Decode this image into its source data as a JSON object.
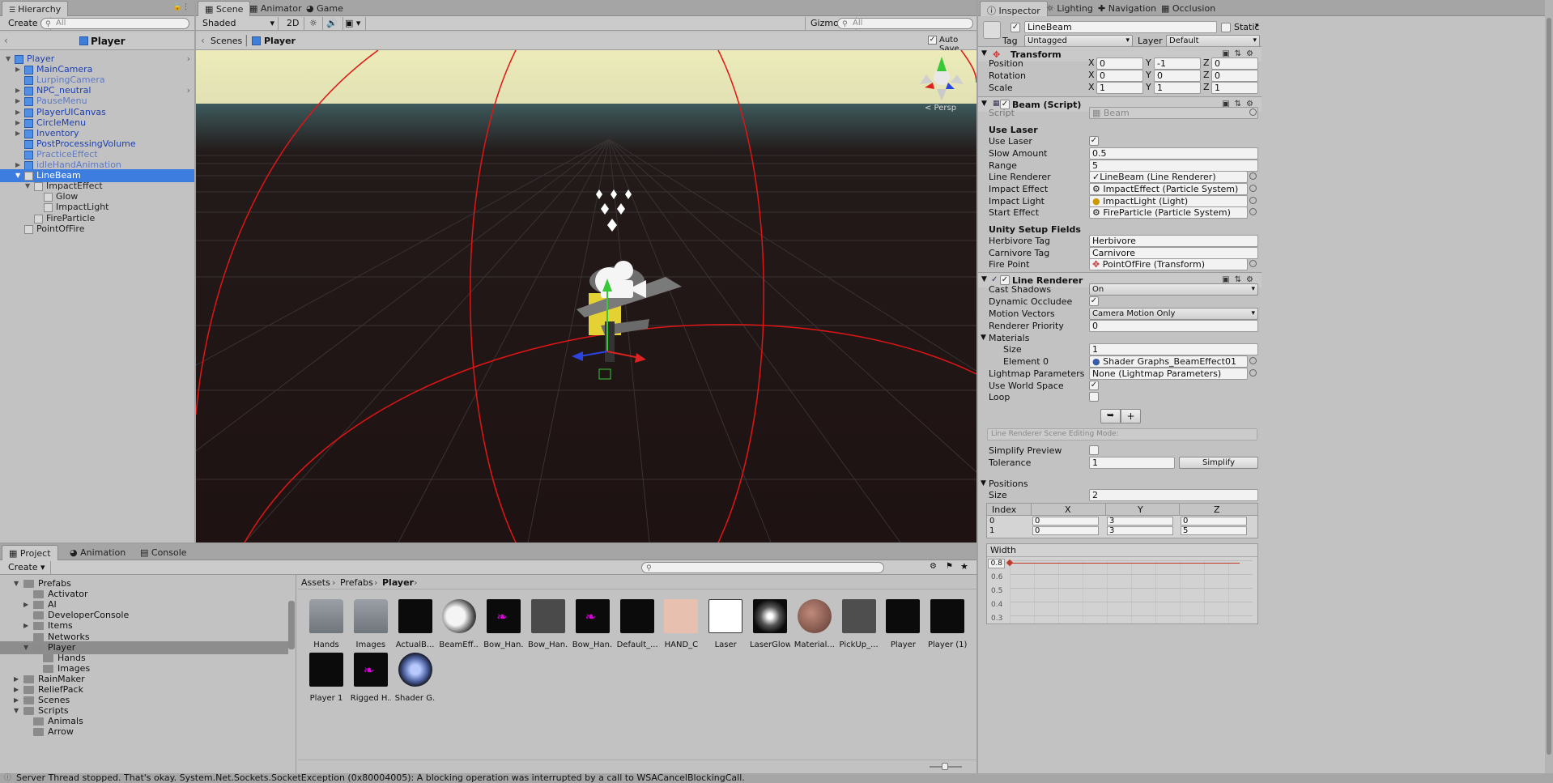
{
  "hierarchy": {
    "tab_label": "Hierarchy",
    "create_label": "Create",
    "search_placeholder": "All",
    "scene_title": "Player",
    "items": [
      {
        "label": "Player"
      },
      {
        "label": "MainCamera"
      },
      {
        "label": "LurpingCamera"
      },
      {
        "label": "NPC_neutral"
      },
      {
        "label": "PauseMenu"
      },
      {
        "label": "PlayerUICanvas"
      },
      {
        "label": "CircleMenu"
      },
      {
        "label": "Inventory"
      },
      {
        "label": "PostProcessingVolume"
      },
      {
        "label": "PracticeEffect"
      },
      {
        "label": "idleHandAnimation"
      },
      {
        "label": "LineBeam"
      },
      {
        "label": "ImpactEffect"
      },
      {
        "label": "Glow"
      },
      {
        "label": "ImpactLight"
      },
      {
        "label": "FireParticle"
      },
      {
        "label": "PointOfFire"
      }
    ]
  },
  "scene": {
    "tabs": [
      {
        "label": "Scene"
      },
      {
        "label": "Animator"
      },
      {
        "label": "Game"
      }
    ],
    "shading_mode": "Shaded",
    "mode_2d": "2D",
    "gizmos_label": "Gizmos",
    "search_placeholder": "All",
    "breadcrumb": [
      "Scenes",
      "Player"
    ],
    "auto_save_label": "Auto Save",
    "persp_label": "< Persp"
  },
  "inspector": {
    "tabs": [
      {
        "label": "Inspector"
      },
      {
        "label": "Lighting"
      },
      {
        "label": "Navigation"
      },
      {
        "label": "Occlusion"
      }
    ],
    "object_name": "LineBeam",
    "static_label": "Static",
    "tag_label": "Tag",
    "tag_value": "Untagged",
    "layer_label": "Layer",
    "layer_value": "Default",
    "transform": {
      "title": "Transform",
      "rows": [
        {
          "label": "Position",
          "x": "0",
          "y": "-1",
          "z": "0"
        },
        {
          "label": "Rotation",
          "x": "0",
          "y": "0",
          "z": "0"
        },
        {
          "label": "Scale",
          "x": "1",
          "y": "1",
          "z": "1"
        }
      ]
    },
    "beam": {
      "title": "Beam (Script)",
      "script_label": "Script",
      "script_value": "Beam",
      "section1": "Use Laser",
      "use_laser_label": "Use Laser",
      "slow_amount_label": "Slow Amount",
      "slow_amount_value": "0.5",
      "range_label": "Range",
      "range_value": "5",
      "line_renderer_label": "Line Renderer",
      "line_renderer_value": "LineBeam (Line Renderer)",
      "impact_effect_label": "Impact Effect",
      "impact_effect_value": "ImpactEffect (Particle System)",
      "impact_light_label": "Impact Light",
      "impact_light_value": "ImpactLight (Light)",
      "start_effect_label": "Start Effect",
      "start_effect_value": "FireParticle (Particle System)",
      "section2": "Unity Setup Fields",
      "herbivore_tag_label": "Herbivore Tag",
      "herbivore_tag_value": "Herbivore",
      "carnivore_tag_label": "Carnivore Tag",
      "carnivore_tag_value": "Carnivore",
      "fire_point_label": "Fire Point",
      "fire_point_value": "PointOfFire (Transform)"
    },
    "line_renderer": {
      "title": "Line Renderer",
      "cast_shadows_label": "Cast Shadows",
      "cast_shadows_value": "On",
      "dynamic_occludee_label": "Dynamic Occludee",
      "motion_vectors_label": "Motion Vectors",
      "motion_vectors_value": "Camera Motion Only",
      "renderer_priority_label": "Renderer Priority",
      "renderer_priority_value": "0",
      "materials_label": "Materials",
      "size_label": "Size",
      "materials_size_value": "1",
      "element0_label": "Element 0",
      "element0_value": "Shader Graphs_BeamEffect01",
      "lightmap_label": "Lightmap Parameters",
      "lightmap_value": "None (Lightmap Parameters)",
      "world_space_label": "Use World Space",
      "loop_label": "Loop",
      "editing_mode_label": "Line Renderer Scene Editing Mode:",
      "simplify_preview_label": "Simplify Preview",
      "tolerance_label": "Tolerance",
      "tolerance_value": "1",
      "simplify_button": "Simplify",
      "positions_label": "Positions",
      "positions_size_label": "Size",
      "positions_size_value": "2",
      "table_headers": [
        "Index",
        "X",
        "Y",
        "Z"
      ],
      "table_rows": [
        {
          "index": "0",
          "x": "0",
          "y": "3",
          "z": "0"
        },
        {
          "index": "1",
          "x": "0",
          "y": "3",
          "z": "5"
        }
      ],
      "width_label": "Width",
      "width_value": "0.8",
      "width_ticks": [
        "0.6",
        "0.5",
        "0.4",
        "0.3"
      ]
    }
  },
  "project": {
    "tabs": [
      {
        "label": "Project"
      },
      {
        "label": "Animation"
      },
      {
        "label": "Console"
      }
    ],
    "create_label": "Create",
    "breadcrumb": [
      "Assets",
      "Prefabs",
      "Player"
    ],
    "tree": [
      {
        "label": "Prefabs"
      },
      {
        "label": "Activator"
      },
      {
        "label": "AI"
      },
      {
        "label": "DeveloperConsole"
      },
      {
        "label": "Items"
      },
      {
        "label": "Networks"
      },
      {
        "label": "Player"
      },
      {
        "label": "Hands"
      },
      {
        "label": "Images"
      },
      {
        "label": "RainMaker"
      },
      {
        "label": "ReliefPack"
      },
      {
        "label": "Scenes"
      },
      {
        "label": "Scripts"
      },
      {
        "label": "Animals"
      },
      {
        "label": "Arrow"
      }
    ],
    "assets": [
      {
        "name": "Hands"
      },
      {
        "name": "Images"
      },
      {
        "name": "ActualB..."
      },
      {
        "name": "BeamEff..."
      },
      {
        "name": "Bow_Han..."
      },
      {
        "name": "Bow_Han..."
      },
      {
        "name": "Bow_Han..."
      },
      {
        "name": "Default_..."
      },
      {
        "name": "HAND_C"
      },
      {
        "name": "Laser"
      },
      {
        "name": "LaserGlow"
      },
      {
        "name": "Material..."
      },
      {
        "name": "PickUp_..."
      },
      {
        "name": "Player"
      },
      {
        "name": "Player (1)"
      },
      {
        "name": "Player 1"
      },
      {
        "name": "Rigged H..."
      },
      {
        "name": "Shader G..."
      }
    ]
  },
  "status_message": "Server Thread stopped. That's okay. System.Net.Sockets.SocketException (0x80004005): A blocking operation was interrupted by a call to WSACancelBlockingCall.",
  "colors": {
    "selection": "#3e7de0",
    "prefab_text": "#1b3fb0",
    "disabled_prefab_text": "#5d79c4",
    "laser_red": "#e01515",
    "sky": "#ecebb9"
  }
}
